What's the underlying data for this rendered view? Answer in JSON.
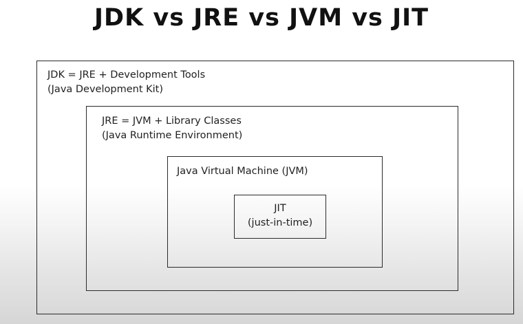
{
  "title": "JDK vs JRE vs JVM vs JIT",
  "jdk": {
    "line1": "JDK = JRE + Development Tools",
    "line2": "(Java Development Kit)"
  },
  "jre": {
    "line1": "JRE = JVM + Library Classes",
    "line2": "(Java Runtime Environment)"
  },
  "jvm": {
    "line1": "Java Virtual Machine (JVM)"
  },
  "jit": {
    "line1": "JIT",
    "line2": "(just-in-time)"
  }
}
